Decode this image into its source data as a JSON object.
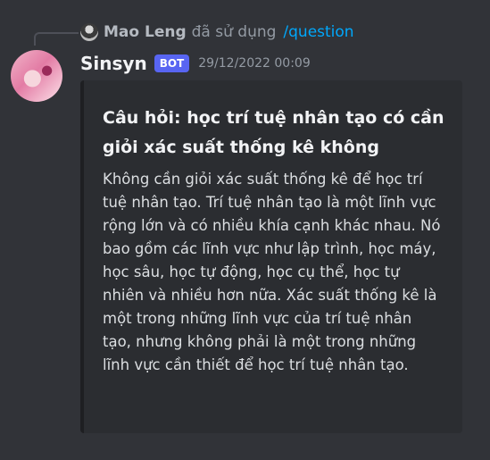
{
  "reply": {
    "name": "Mao Leng",
    "text": "đã sử dụng",
    "command": "/question",
    "avatar_icon": "user-avatar-icon"
  },
  "message": {
    "username": "Sinsyn",
    "badge": "BOT",
    "timestamp": "29/12/2022 00:09",
    "avatar_icon": "bot-avatar-icon"
  },
  "embed": {
    "title": "Câu hỏi: học trí tuệ nhân tạo có cần giỏi xác suất thống kê không",
    "description": "Không cần giỏi xác suất thống kê để học trí tuệ nhân tạo. Trí tuệ nhân tạo là một lĩnh vực rộng lớn và có nhiều khía cạnh khác nhau. Nó bao gồm các lĩnh vực như lập trình, học máy, học sâu, học tự động, học cụ thể, học tự nhiên và nhiều hơn nữa. Xác suất thống kê là một trong những lĩnh vực của trí tuệ nhân tạo, nhưng không phải là một trong những lĩnh vực cần thiết để học trí tuệ nhân tạo.",
    "accent_color": "#1e1f22"
  },
  "colors": {
    "background": "#313338",
    "embed_bg": "#2b2d31",
    "badge": "#5865f2",
    "command_link": "#00a8fc"
  }
}
